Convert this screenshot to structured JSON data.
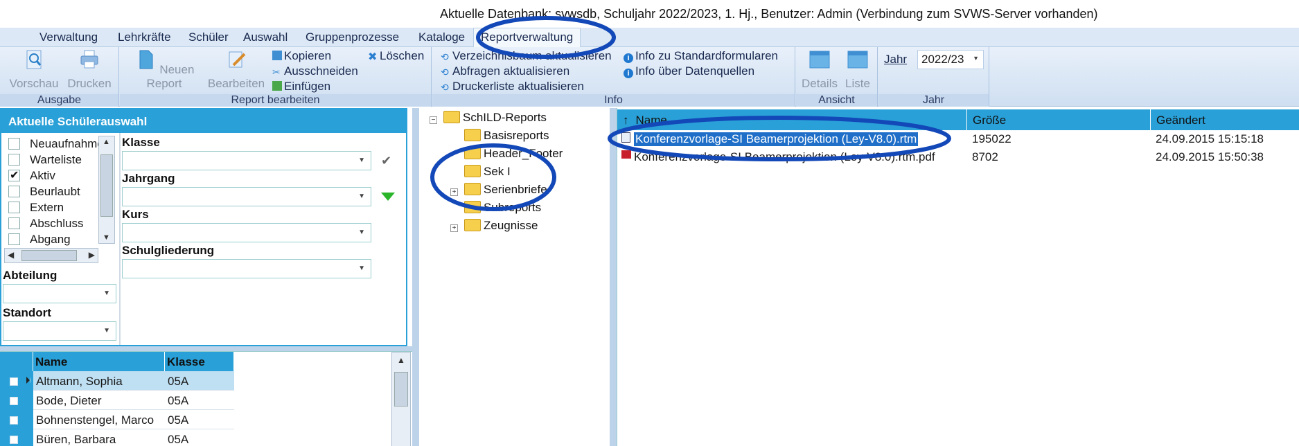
{
  "window": {
    "title": "Aktuelle Datenbank: svwsdb, Schuljahr 2022/2023, 1. Hj., Benutzer: Admin (Verbindung zum SVWS-Server vorhanden)"
  },
  "menu": {
    "tabs": [
      "Verwaltung",
      "Lehrkräfte",
      "Schüler",
      "Auswahl",
      "Gruppenprozesse",
      "Kataloge",
      "Reportverwaltung"
    ],
    "active": "Reportverwaltung"
  },
  "ribbon": {
    "ausgabe": {
      "label": "Ausgabe",
      "vorschau": "Vorschau",
      "drucken": "Drucken"
    },
    "report": {
      "label": "Report bearbeiten",
      "neuer_report": "Neuen Report",
      "bearbeiten": "Bearbeiten",
      "kopieren": "Kopieren",
      "ausschneiden": "Ausschneiden",
      "einfuegen": "Einfügen",
      "loeschen": "Löschen"
    },
    "info": {
      "label": "Info",
      "verzeichnisbaum": "Verzeichnisbaum aktualisieren",
      "abfragen": "Abfragen aktualisieren",
      "druckerliste": "Druckerliste aktualisieren",
      "standardformulare": "Info zu Standardformularen",
      "datenquellen": "Info über Datenquellen"
    },
    "ansicht": {
      "label": "Ansicht",
      "details": "Details",
      "liste": "Liste"
    },
    "jahr": {
      "label": "Jahr",
      "field_label": "Jahr",
      "value": "2022/23"
    }
  },
  "filter": {
    "header": "Aktuelle Schülerauswahl",
    "status_items": [
      {
        "label": "Neuaufnahme",
        "checked": false
      },
      {
        "label": "Warteliste",
        "checked": false
      },
      {
        "label": "Aktiv",
        "checked": true
      },
      {
        "label": "Beurlaubt",
        "checked": false
      },
      {
        "label": "Extern",
        "checked": false
      },
      {
        "label": "Abschluss",
        "checked": false
      },
      {
        "label": "Abgang",
        "checked": false
      }
    ],
    "klasse": "Klasse",
    "jahrgang": "Jahrgang",
    "kurs": "Kurs",
    "schulgliederung": "Schulgliederung",
    "abteilung": "Abteilung",
    "standort": "Standort"
  },
  "students": {
    "columns": [
      "Name",
      "Klasse"
    ],
    "rows": [
      {
        "name": "Altmann, Sophia",
        "klasse": "05A"
      },
      {
        "name": "Bode, Dieter",
        "klasse": "05A"
      },
      {
        "name": "Bohnenstengel, Marco",
        "klasse": "05A"
      },
      {
        "name": "Büren, Barbara",
        "klasse": "05A"
      }
    ]
  },
  "tree": {
    "root": "SchILD-Reports",
    "children": [
      "Basisreports",
      "Header_Footer",
      "Sek I",
      "Serienbriefe",
      "Subreports",
      "Zeugnisse"
    ]
  },
  "files": {
    "columns": [
      "Name",
      "Größe",
      "Geändert"
    ],
    "rows": [
      {
        "name": "Konferenzvorlage-SI Beamerprojektion (Ley-V8.0).rtm",
        "size": "195022",
        "changed": "24.09.2015 15:15:18"
      },
      {
        "name": "Konferenzvorlage-SI Beamerprojektion (Ley-V8.0).rtm.pdf",
        "size": "8702",
        "changed": "24.09.2015 15:50:38"
      }
    ]
  },
  "colors": {
    "accent": "#29a0d8",
    "annotation": "#1348b8",
    "selection": "#1f6fc8"
  }
}
